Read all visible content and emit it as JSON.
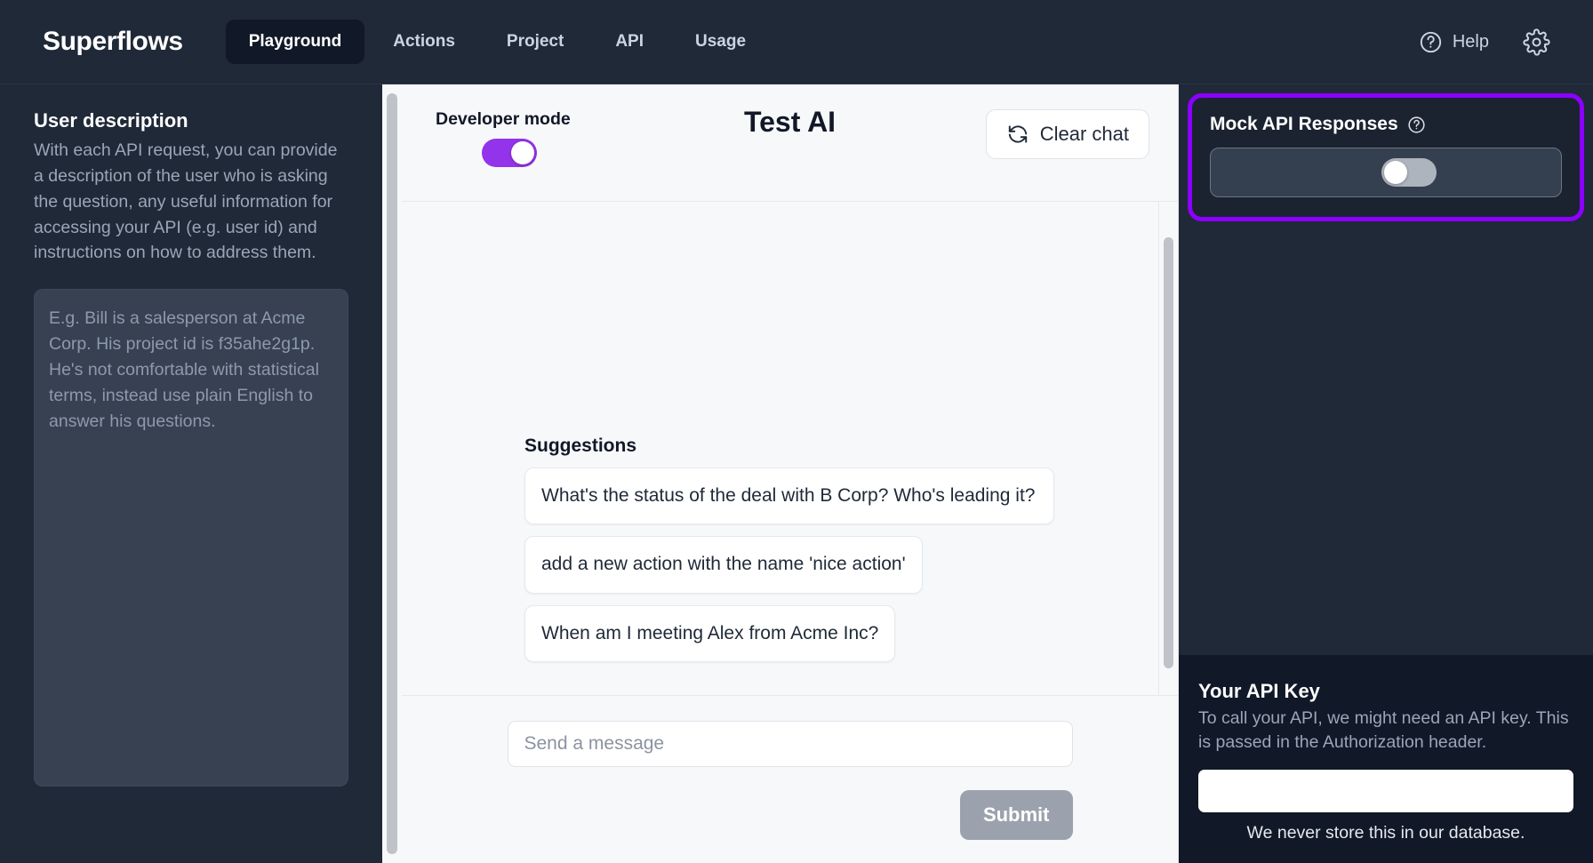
{
  "header": {
    "brand": "Superflows",
    "nav": [
      {
        "label": "Playground",
        "active": true
      },
      {
        "label": "Actions",
        "active": false
      },
      {
        "label": "Project",
        "active": false
      },
      {
        "label": "API",
        "active": false
      },
      {
        "label": "Usage",
        "active": false
      }
    ],
    "help_label": "Help",
    "help_icon": "question-circle-icon",
    "settings_icon": "gear-icon"
  },
  "sidebar": {
    "title": "User description",
    "description": "With each API request, you can provide a description of the user who is asking the question, any useful information for accessing your API (e.g. user id) and instructions on how to address them.",
    "textarea_placeholder": "E.g. Bill is a salesperson at Acme Corp. His project id is f35ahe2g1p. He's not comfortable with statistical terms, instead use plain English to answer his questions.",
    "textarea_value": ""
  },
  "center": {
    "developer_mode_label": "Developer mode",
    "developer_mode_on": true,
    "title": "Test AI",
    "clear_chat_label": "Clear chat",
    "clear_chat_icon": "refresh-icon",
    "suggestions_title": "Suggestions",
    "suggestions": [
      "What's the status of the deal with B Corp? Who's leading it?",
      "add a new action with the name 'nice action'",
      "When am I meeting Alex from Acme Inc?"
    ],
    "message_placeholder": "Send a message",
    "message_value": "",
    "submit_label": "Submit"
  },
  "right": {
    "mock_title": "Mock API Responses",
    "mock_help_icon": "question-circle-icon",
    "mock_enabled": false,
    "highlight_color": "#8b00ff",
    "apikey_title": "Your API Key",
    "apikey_description": "To call your API, we might need an API key. This is passed in the Authorization header.",
    "apikey_value": "",
    "apikey_note": "We never store this in our database."
  },
  "colors": {
    "accent": "#9333ea",
    "highlight": "#8b00ff",
    "header_bg": "#1f2937",
    "panel_bg": "#111827",
    "canvas_bg": "#f7f8fa"
  }
}
